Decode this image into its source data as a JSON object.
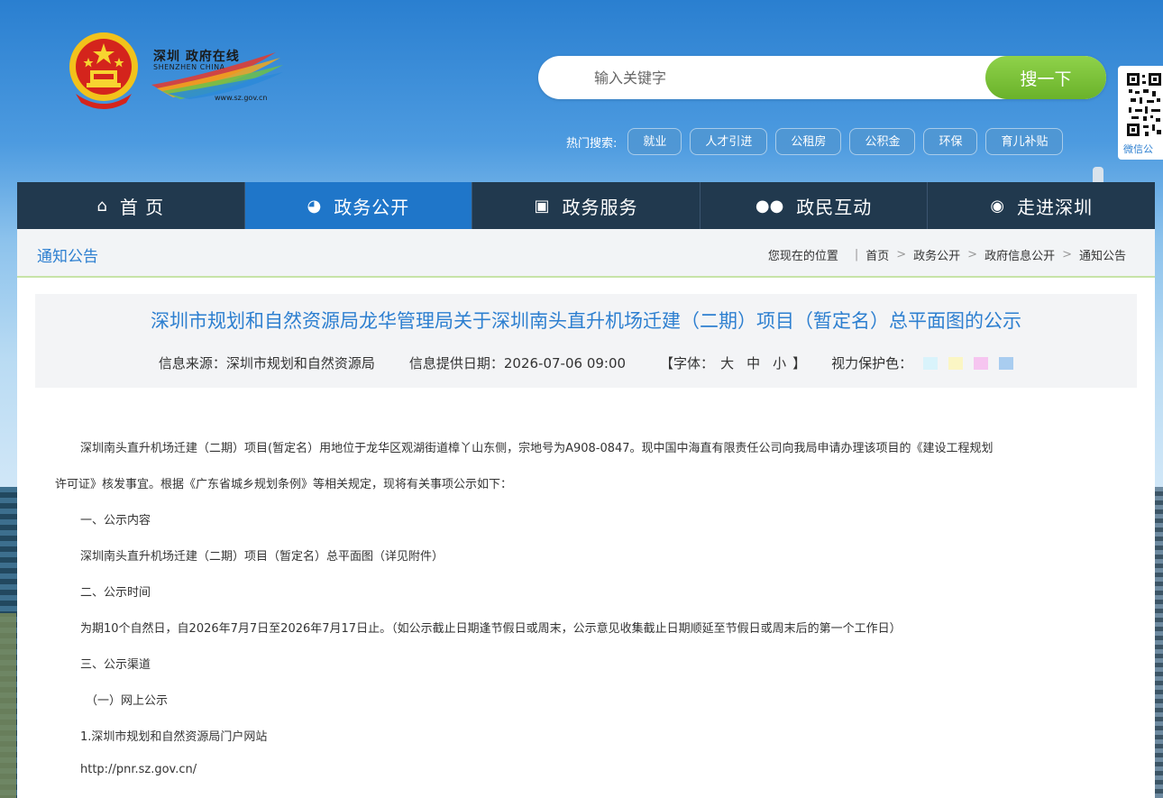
{
  "header": {
    "logo_cn": "深圳 政府在线",
    "logo_en": "SHENZHEN CHINA",
    "logo_url": "www.sz.gov.cn",
    "search_placeholder": "输入关键字",
    "search_button": "搜一下",
    "hot_label": "热门搜索:",
    "hot_tags": [
      "就业",
      "人才引进",
      "公租房",
      "公积金",
      "环保",
      "育儿补贴"
    ],
    "qr_label": "微信公"
  },
  "nav": [
    {
      "label": "首 页",
      "icon": "home-icon",
      "active": false
    },
    {
      "label": "政务公开",
      "icon": "globe-icon",
      "active": true
    },
    {
      "label": "政务服务",
      "icon": "monitor-icon",
      "active": false
    },
    {
      "label": "政民互动",
      "icon": "people-icon",
      "active": false
    },
    {
      "label": "走进深圳",
      "icon": "chat-icon",
      "active": false
    }
  ],
  "breadcrumb": {
    "section_title": "通知公告",
    "lead": "您现在的位置",
    "items": [
      "首页",
      "政务公开",
      "政府信息公开",
      "通知公告"
    ]
  },
  "article": {
    "title": "深圳市规划和自然资源局龙华管理局关于深圳南头直升机场迁建（二期）项目（暂定名）总平面图的公示",
    "source": "信息来源：深圳市规划和自然资源局",
    "date": "信息提供日期：2026-07-06 09:00",
    "font_label": "【字体：",
    "font_options": [
      "大",
      "中",
      "小"
    ],
    "font_close": "】",
    "eye_label": "视力保护色：",
    "eye_colors": [
      "#d9f3fb",
      "#fbf6c4",
      "#f6c5f0",
      "#a9cdf0"
    ],
    "paragraphs": [
      "深圳南头直升机场迁建（二期）项目(暂定名）用地位于龙华区观湖街道樟丫山东侧，宗地号为A908-0847。现中国中海直有限责任公司向我局申请办理该项目的《建设工程规划",
      "许可证》核发事宜。根据《广东省城乡规划条例》等相关规定，现将有关事项公示如下：",
      "一、公示内容",
      "深圳南头直升机场迁建（二期）项目（暂定名）总平面图（详见附件）",
      "二、公示时间",
      "为期10个自然日，自2026年7月7日至2026年7月17日止。（如公示截止日期逢节假日或周末，公示意见收集截止日期顺延至节假日或周末后的第一个工作日）",
      "三、公示渠道",
      "（一）网上公示",
      "1.深圳市规划和自然资源局门户网站",
      "http://pnr.sz.gov.cn/"
    ]
  }
}
